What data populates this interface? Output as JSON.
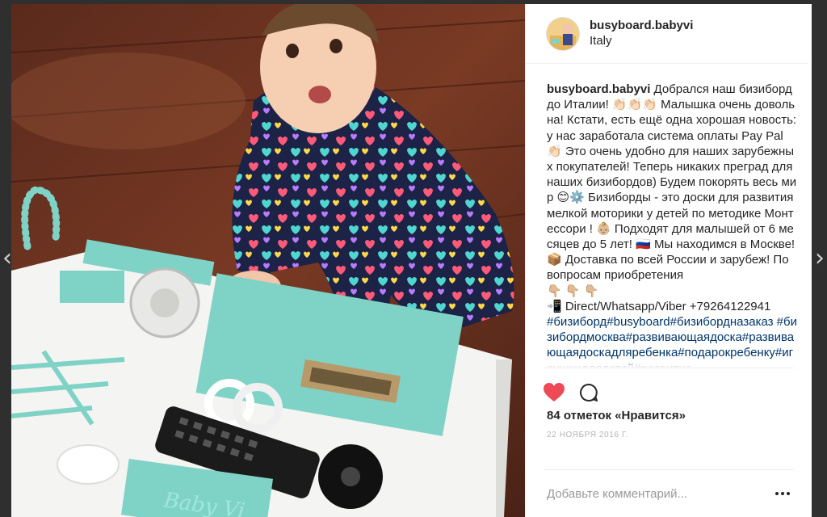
{
  "post": {
    "username": "busyboard.babyvi",
    "location": "Italy",
    "caption_author": "busyboard.babyvi",
    "caption_text": "Добрался наш бизиборд до Италии! 👏🏻👏🏻👏🏻 Малышка очень довольна! Кстати, есть ещё одна хорошая новость: у нас заработала система оплаты Pay Pal 👏🏻 Это очень удобно для наших зарубежных покупателей! Теперь никаких преград для наших бизибордов) Будем покорять весь мир 😊⚙️ Бизиборды - это доски для развития мелкой моторики у детей по методике Монтессори ! 👶🏼 Подходят для малышей от 6 месяцев до 5 лет! 🇷🇺 Мы находимся в Москве!",
    "caption_delivery": "📦 Доставка по всей России и зарубеж! По вопросам приобретения",
    "caption_pointers": "👇🏼 👇🏼 👇🏼",
    "caption_contact": "📲 Direct/Whatsapp/Viber +79264122941",
    "caption_tags": "#бизиборд#busyboard#бизибордназаказ #бизибордмосква#развивающаядоска#развивающаядоскадляребенка#подарокребенку#игрушкидлядетей#развитие",
    "likes": "84 отметок «Нравится»",
    "date": "22 ноября 2016 г.",
    "comment_placeholder": "Добавьте комментарий..."
  },
  "icons": {
    "like": "heart-icon",
    "comment": "comment-icon",
    "more": "more-options-icon",
    "prev": "chevron-left-icon",
    "next": "chevron-right-icon"
  },
  "colors": {
    "heart_red": "#ed4956",
    "link_blue": "#003569",
    "text": "#262626",
    "muted": "#b4b4b4",
    "board_mint": "#7fd3c6"
  },
  "photo_overlay": {
    "board_logo": "Baby Vi"
  }
}
